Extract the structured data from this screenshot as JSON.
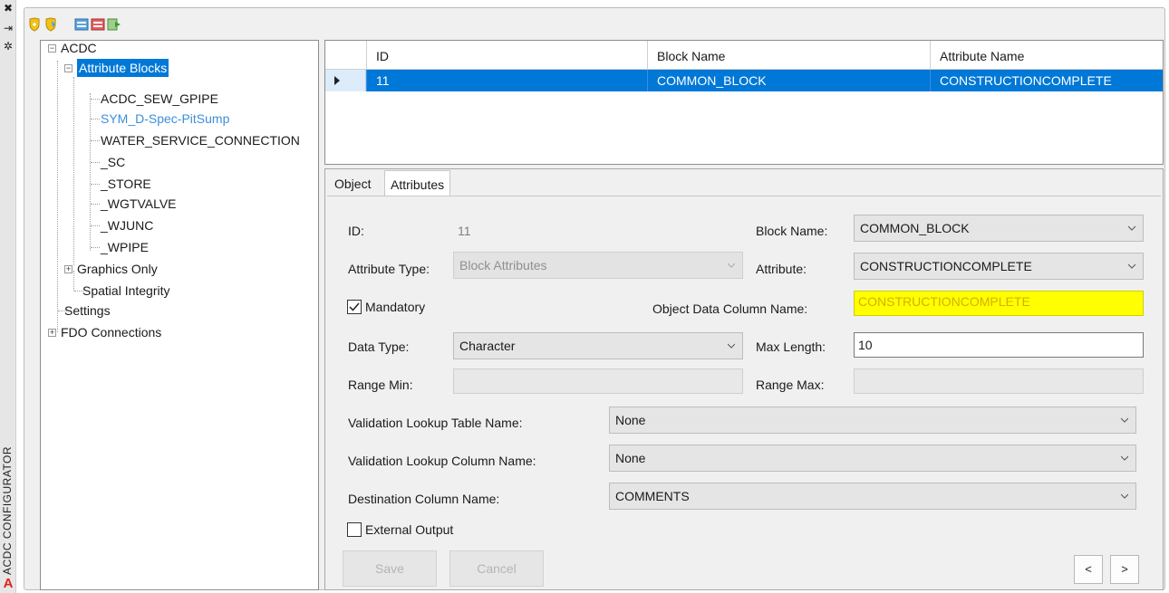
{
  "palette": {
    "title": "ACDC CONFIGURATOR",
    "close_icon": "close-icon",
    "autohide_icon": "autohide-icon",
    "properties_icon": "properties-icon",
    "logo": "A"
  },
  "toolbar": {
    "icons": [
      "shield-add-icon",
      "shield-edit-icon",
      "import-icon",
      "export-icon",
      "refresh-icon"
    ]
  },
  "tree": {
    "root": "ACDC",
    "attribute_blocks": "Attribute Blocks",
    "blocks": [
      "ACDC_SEW_GPIPE",
      "SYM_D-Spec-PitSump",
      "WATER_SERVICE_CONNECTION",
      "_SC",
      "_STORE",
      "_WGTVALVE",
      "_WJUNC",
      "_WPIPE"
    ],
    "graphics_only": "Graphics Only",
    "spatial_integrity": "Spatial Integrity",
    "settings": "Settings",
    "fdo_connections": "FDO Connections",
    "selected": "Attribute Blocks",
    "link_item": "SYM_D-Spec-PitSump"
  },
  "grid": {
    "columns": [
      "ID",
      "Block Name",
      "Attribute Name"
    ],
    "rows": [
      {
        "id": "11",
        "block_name": "COMMON_BLOCK",
        "attribute_name": "CONSTRUCTIONCOMPLETE"
      }
    ]
  },
  "tabs": [
    "Object",
    "Attributes"
  ],
  "active_tab": "Attributes",
  "form": {
    "id_label": "ID:",
    "id_value": "11",
    "block_name_label": "Block Name:",
    "block_name_value": "COMMON_BLOCK",
    "attribute_type_label": "Attribute Type:",
    "attribute_type_value": "Block Attributes",
    "attribute_label": "Attribute:",
    "attribute_value": "CONSTRUCTIONCOMPLETE",
    "mandatory_label": "Mandatory",
    "mandatory_checked": true,
    "od_column_label": "Object Data Column Name:",
    "od_column_value": "CONSTRUCTIONCOMPLETE",
    "data_type_label": "Data Type:",
    "data_type_value": "Character",
    "max_length_label": "Max Length:",
    "max_length_value": "10",
    "range_min_label": "Range Min:",
    "range_min_value": "",
    "range_max_label": "Range Max:",
    "range_max_value": "",
    "lookup_table_label": "Validation Lookup Table Name:",
    "lookup_table_value": "None",
    "lookup_column_label": "Validation Lookup Column Name:",
    "lookup_column_value": "None",
    "dest_column_label": "Destination Column Name:",
    "dest_column_value": "COMMENTS",
    "external_output_label": "External Output",
    "external_output_checked": false,
    "save_label": "Save",
    "cancel_label": "Cancel",
    "prev_label": "<",
    "next_label": ">"
  },
  "colors": {
    "selection": "#0078d7",
    "highlight_field": "#ffff00",
    "link_text": "#3c8fd9",
    "logo": "#e2231a"
  }
}
